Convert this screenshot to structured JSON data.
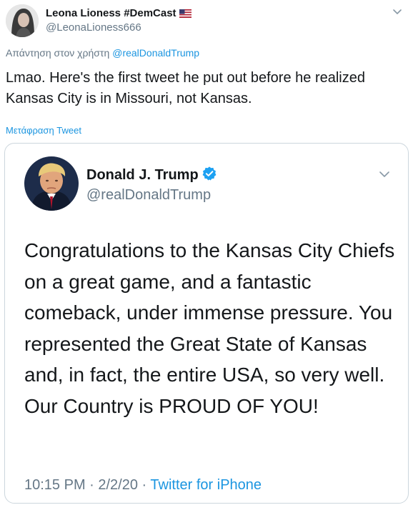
{
  "author": {
    "name": "Leona Lioness #DemCast",
    "flag": "US flag emoji",
    "handle": "@LeonaLioness666"
  },
  "reply": {
    "prefix": "Απάντηση στον χρήστη",
    "mention": "@realDonaldTrump"
  },
  "tweet": {
    "text": "Lmao. Here's the first tweet he put out before he realized Kansas City is in Missouri, not Kansas.",
    "translate_label": "Μετάφραση Tweet"
  },
  "quoted": {
    "name": "Donald J. Trump",
    "handle": "@realDonaldTrump",
    "text": "Congratulations to the Kansas City Chiefs on a great game, and a fantastic comeback, under immense pressure. You represented the Great State of Kansas and, in fact, the entire USA, so very well. Our Country is PROUD OF YOU!",
    "time": "10:15 PM · 2/2/20 · ",
    "source": "Twitter for iPhone"
  },
  "colors": {
    "link": "#1b95e0",
    "secondary_text": "#657786",
    "primary_text": "#14171a",
    "border": "#ccd6dd"
  }
}
